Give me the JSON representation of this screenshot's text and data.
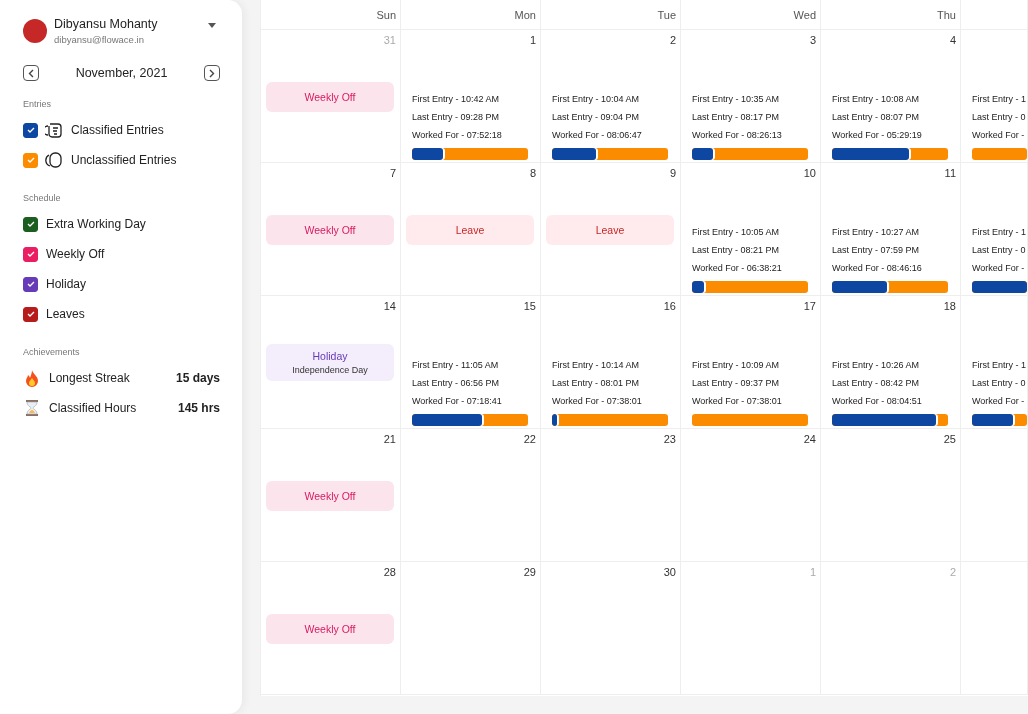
{
  "user": {
    "name": "Dibyansu Mohanty",
    "email": "dibyansu@flowace.in"
  },
  "month": "November, 2021",
  "sections": [
    {
      "title": "Entries",
      "items": [
        {
          "kind": "classified",
          "label": "Classified Entries",
          "checked": true,
          "color": "#0d47a1"
        },
        {
          "kind": "unclassified",
          "label": "Unclassified Entries",
          "checked": true,
          "color": "#fb8c00"
        }
      ]
    },
    {
      "title": "Schedule",
      "items": [
        {
          "kind": "check",
          "label": "Extra Working Day",
          "checked": true,
          "color": "#1b5e20"
        },
        {
          "kind": "check",
          "label": "Weekly Off",
          "checked": true,
          "color": "#e91e63"
        },
        {
          "kind": "check",
          "label": "Holiday",
          "checked": true,
          "color": "#673ab7"
        },
        {
          "kind": "check",
          "label": "Leaves",
          "checked": true,
          "color": "#b71c1c"
        }
      ]
    },
    {
      "title": "Achievements",
      "items": [
        {
          "kind": "streak",
          "label": "Longest Streak",
          "value": "15 days"
        },
        {
          "kind": "hours",
          "label": "Classified Hours",
          "value": "145 hrs"
        }
      ]
    }
  ],
  "calendar": {
    "weekdays": [
      "Sun",
      "Mon",
      "Tue",
      "Wed",
      "Thu"
    ],
    "weeks": [
      [
        {
          "date": "31",
          "outside_month": true,
          "event": {
            "kind": "weekly_off",
            "label": "Weekly Off"
          }
        },
        {
          "date": "1",
          "outside_month": false,
          "lines": [
            "First Entry - 10:42 AM",
            "Last Entry - 09:28 PM",
            "Worked For - 07:52:18"
          ],
          "level": 0.27
        },
        {
          "date": "2",
          "outside_month": false,
          "lines": [
            "First Entry - 10:04 AM",
            "Last Entry - 09:04 PM",
            "Worked For - 08:06:47"
          ],
          "level": 0.38
        },
        {
          "date": "3",
          "outside_month": false,
          "lines": [
            "First Entry - 10:35 AM",
            "Last Entry - 08:17 PM",
            "Worked For - 08:26:13"
          ],
          "level": 0.18
        },
        {
          "date": "4",
          "outside_month": false,
          "lines": [
            "First Entry - 10:08 AM",
            "Last Entry - 08:07 PM",
            "Worked For - 05:29:19"
          ],
          "level": 0.66
        },
        {
          "lines": [
            "First Entry - 1",
            "Last Entry - 0",
            "Worked For -"
          ],
          "level": 0
        }
      ],
      [
        {
          "date": "7",
          "outside_month": false,
          "event": {
            "kind": "weekly_off",
            "label": "Weekly Off"
          }
        },
        {
          "date": "8",
          "outside_month": false,
          "event": {
            "kind": "leave",
            "label": "Leave"
          }
        },
        {
          "date": "9",
          "outside_month": false,
          "event": {
            "kind": "leave",
            "label": "Leave"
          }
        },
        {
          "date": "10",
          "outside_month": false,
          "lines": [
            "First Entry - 10:05 AM",
            "Last Entry - 08:21 PM",
            "Worked For - 06:38:21"
          ],
          "level": 0.1
        },
        {
          "date": "11",
          "outside_month": false,
          "lines": [
            "First Entry - 10:27 AM",
            "Last Entry - 07:59 PM",
            "Worked For - 08:46:16"
          ],
          "level": 0.47
        },
        {
          "lines": [
            "First Entry - 1",
            "Last Entry - 0",
            "Worked For -"
          ],
          "level": 1
        }
      ],
      [
        {
          "date": "14",
          "outside_month": false,
          "event": {
            "kind": "holiday",
            "label": "Holiday",
            "detail": "Independence Day"
          }
        },
        {
          "date": "15",
          "outside_month": false,
          "lines": [
            "First Entry - 11:05 AM",
            "Last Entry - 06:56 PM",
            "Worked For - 07:18:41"
          ],
          "level": 0.6
        },
        {
          "date": "16",
          "outside_month": false,
          "lines": [
            "First Entry - 10:14 AM",
            "Last Entry - 08:01 PM",
            "Worked For - 07:38:01"
          ],
          "level": 0.04
        },
        {
          "date": "17",
          "outside_month": false,
          "lines": [
            "First Entry - 10:09 AM",
            "Last Entry - 09:37 PM",
            "Worked For - 07:38:01"
          ],
          "level": 0
        },
        {
          "date": "18",
          "outside_month": false,
          "lines": [
            "First Entry - 10:26 AM",
            "Last Entry - 08:42 PM",
            "Worked For - 08:04:51"
          ],
          "level": 0.9
        },
        {
          "lines": [
            "First Entry - 1",
            "Last Entry - 0",
            "Worked For -"
          ],
          "level": 0.75
        }
      ],
      [
        {
          "date": "21",
          "outside_month": false,
          "event": {
            "kind": "weekly_off",
            "label": "Weekly Off"
          }
        },
        {
          "date": "22",
          "outside_month": false
        },
        {
          "date": "23",
          "outside_month": false
        },
        {
          "date": "24",
          "outside_month": false
        },
        {
          "date": "25",
          "outside_month": false
        }
      ],
      [
        {
          "date": "28",
          "outside_month": false,
          "event": {
            "kind": "weekly_off",
            "label": "Weekly Off"
          }
        },
        {
          "date": "29",
          "outside_month": false
        },
        {
          "date": "30",
          "outside_month": false
        },
        {
          "date": "1",
          "outside_month": true
        },
        {
          "date": "2",
          "outside_month": true
        }
      ]
    ]
  }
}
